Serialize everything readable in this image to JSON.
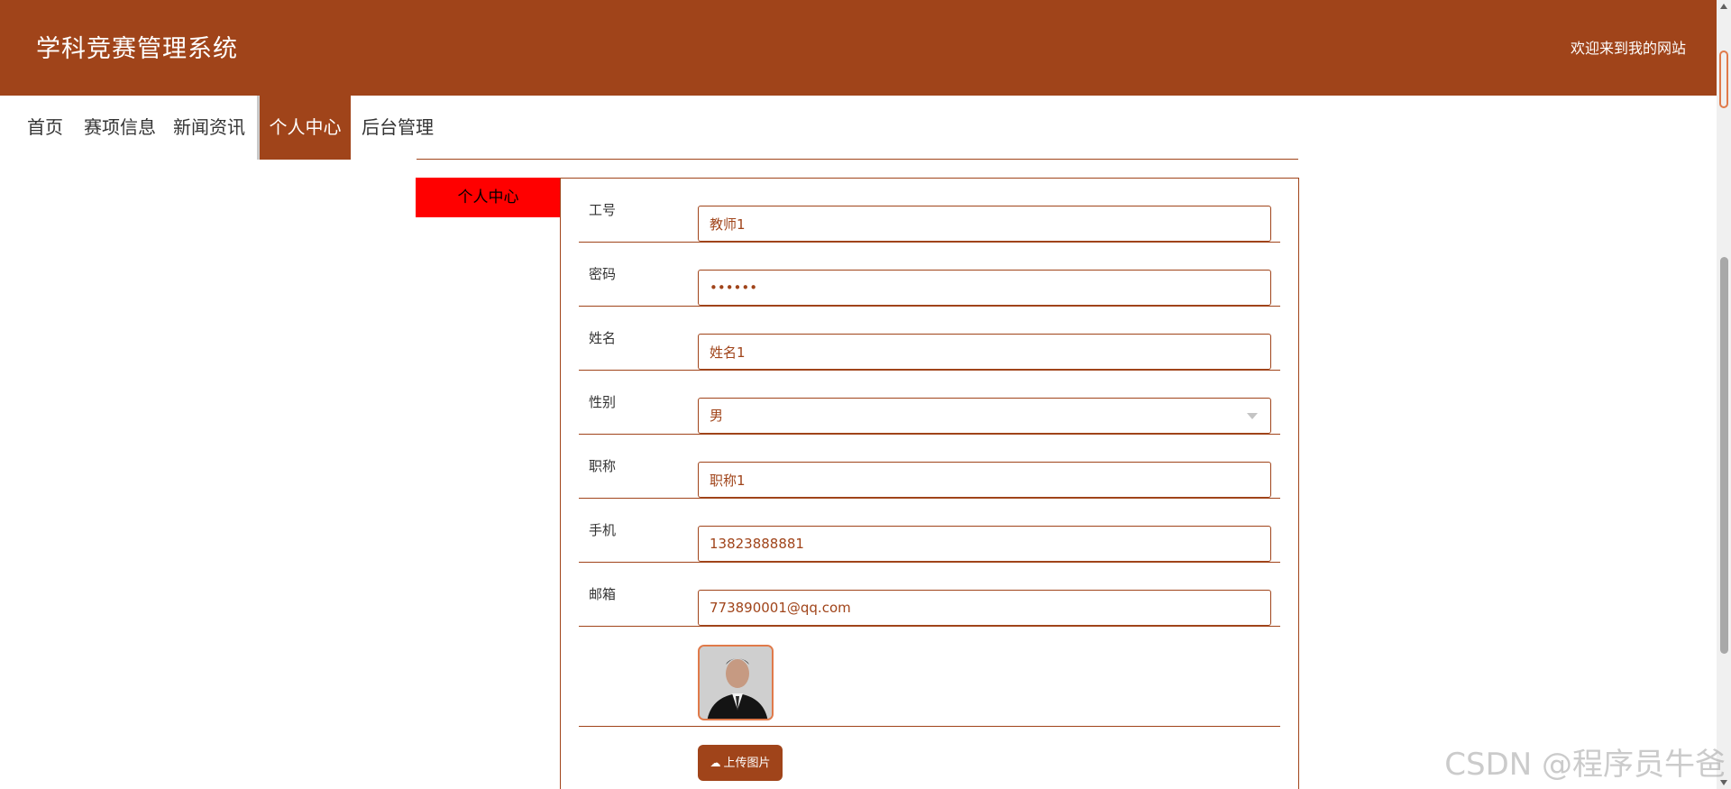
{
  "header": {
    "title": "学科竞赛管理系统",
    "welcome": "欢迎来到我的网站",
    "background": "#a0441a"
  },
  "nav": {
    "items": [
      {
        "label": "首页"
      },
      {
        "label": "赛项信息"
      },
      {
        "label": "新闻资讯"
      },
      {
        "label": "个人中心",
        "active": true
      },
      {
        "label": "后台管理"
      }
    ]
  },
  "side": {
    "tab_label": "个人中心",
    "tab_color": "#ff0000"
  },
  "form": {
    "fields": [
      {
        "label": "工号",
        "value": "教师1"
      },
      {
        "label": "密码",
        "value": "••••••"
      },
      {
        "label": "姓名",
        "value": "姓名1"
      },
      {
        "label": "性别",
        "value": "男"
      },
      {
        "label": "职称",
        "value": "职称1"
      },
      {
        "label": "手机",
        "value": "13823888881"
      },
      {
        "label": "邮箱",
        "value": "773890001@qq.com"
      }
    ],
    "upload_label": "上传图片",
    "upload_icon": "cloud-upload-icon"
  },
  "watermark": "CSDN @程序员牛爸"
}
